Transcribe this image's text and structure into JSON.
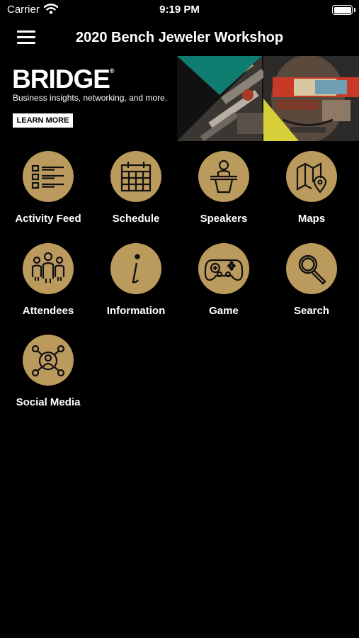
{
  "status": {
    "carrier": "Carrier",
    "time": "9:19 PM"
  },
  "header": {
    "title": "2020 Bench Jeweler Workshop"
  },
  "banner": {
    "brand": "BRIDGE",
    "registered_mark": "®",
    "tagline": "Business insights, networking, and more.",
    "cta": "LEARN MORE"
  },
  "grid": {
    "items": [
      {
        "label": "Activity Feed",
        "icon": "list-icon"
      },
      {
        "label": "Schedule",
        "icon": "calendar-icon"
      },
      {
        "label": "Speakers",
        "icon": "podium-icon"
      },
      {
        "label": "Maps",
        "icon": "map-icon"
      },
      {
        "label": "Attendees",
        "icon": "people-icon"
      },
      {
        "label": "Information",
        "icon": "info-icon"
      },
      {
        "label": "Game",
        "icon": "gamepad-icon"
      },
      {
        "label": "Search",
        "icon": "search-icon"
      },
      {
        "label": "Social Media",
        "icon": "network-icon"
      }
    ]
  },
  "colors": {
    "background": "#000000",
    "icon_circle": "#bb9a5e",
    "icon_stroke": "#111111"
  }
}
